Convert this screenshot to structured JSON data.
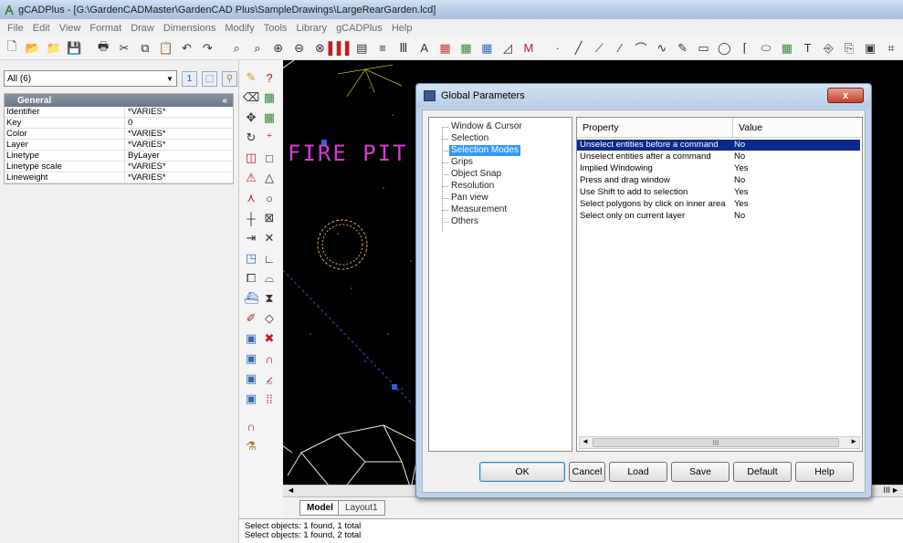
{
  "window": {
    "title": "gCADPlus - [G:\\GardenCADMaster\\GardenCAD Plus\\SampleDrawings\\LargeRearGarden.lcd]"
  },
  "menu": [
    "File",
    "Edit",
    "View",
    "Format",
    "Draw",
    "Dimensions",
    "Modify",
    "Tools",
    "Library",
    "gCADPlus",
    "Help"
  ],
  "properties_panel": {
    "selector_value": "All (6)",
    "section_title": "General",
    "rows": [
      {
        "key": "Identifier",
        "value": "*VARIES*"
      },
      {
        "key": "Key",
        "value": "0"
      },
      {
        "key": "Color",
        "value": "*VARIES*"
      },
      {
        "key": "Layer",
        "value": "*VARIES*"
      },
      {
        "key": "Linetype",
        "value": "ByLayer"
      },
      {
        "key": "Linetype scale",
        "value": "*VARIES*"
      },
      {
        "key": "Lineweight",
        "value": "*VARIES*"
      }
    ]
  },
  "canvas": {
    "label_text": "FIRE PIT"
  },
  "layout_tabs": [
    "Model",
    "Layout1"
  ],
  "hscroll": {
    "left_arrow": "◄",
    "right_arrow": "►",
    "thumb_mark": "III"
  },
  "command_line": [
    "Select objects: 1 found,  1 total",
    "Select objects: 1 found,  2 total"
  ],
  "dialog": {
    "title": "Global Parameters",
    "close_label": "x",
    "tree": [
      {
        "label": "Window & Cursor",
        "selected": false
      },
      {
        "label": "Selection",
        "selected": false
      },
      {
        "label": "Selection Modes",
        "selected": true
      },
      {
        "label": "Grips",
        "selected": false
      },
      {
        "label": "Object Snap",
        "selected": false
      },
      {
        "label": "Resolution",
        "selected": false
      },
      {
        "label": "Pan view",
        "selected": false
      },
      {
        "label": "Measurement",
        "selected": false
      },
      {
        "label": "Others",
        "selected": false
      }
    ],
    "columns": {
      "property": "Property",
      "value": "Value"
    },
    "rows": [
      {
        "property": "Unselect entities before a command",
        "value": "No",
        "selected": true
      },
      {
        "property": "Unselect entities after a command",
        "value": "No",
        "selected": false
      },
      {
        "property": "Implied Windowing",
        "value": "Yes",
        "selected": false
      },
      {
        "property": "Press and drag window",
        "value": "No",
        "selected": false
      },
      {
        "property": "Use Shift to add to selection",
        "value": "Yes",
        "selected": false
      },
      {
        "property": "Select polygons by click on inner area",
        "value": "Yes",
        "selected": false
      },
      {
        "property": "Select only on current layer",
        "value": "No",
        "selected": false
      }
    ],
    "scroll": {
      "left_arrow": "◄",
      "right_arrow": "►",
      "thumb_mark": "III"
    },
    "buttons": {
      "ok": "OK",
      "cancel": "Cancel",
      "load": "Load",
      "save": "Save",
      "default": "Default",
      "help": "Help"
    }
  },
  "colors": {
    "selection_highlight": "#0b2a8c",
    "tree_highlight": "#3399ff",
    "canvas_bg": "#000000",
    "fire_pit_label": "#d63bd0"
  }
}
